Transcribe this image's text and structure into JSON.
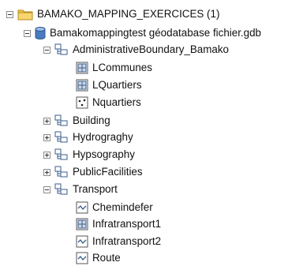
{
  "tree": {
    "root": "BAMAKO_MAPPING_EXERCICES (1)",
    "gdb": "Bamakomappingtest géodatabase fichier.gdb",
    "dataset_admin": "AdministrativeBoundary_Bamako",
    "fc_lcommunes": "LCommunes",
    "fc_lquartiers": "LQuartiers",
    "fc_nquartiers": "Nquartiers",
    "dataset_building": "Building",
    "dataset_hydro": "Hydrograghy",
    "dataset_hypso": "Hypsography",
    "dataset_public": "PublicFacilities",
    "dataset_transport": "Transport",
    "fc_chemindefer": "Chemindefer",
    "fc_infratransport1": "Infratransport1",
    "fc_infratransport2": "Infratransport2",
    "fc_route": "Route"
  },
  "colors": {
    "folder": "#f3c64a",
    "gdb": "#4b7bbf",
    "polygon_fill": "#c9d6e6"
  }
}
